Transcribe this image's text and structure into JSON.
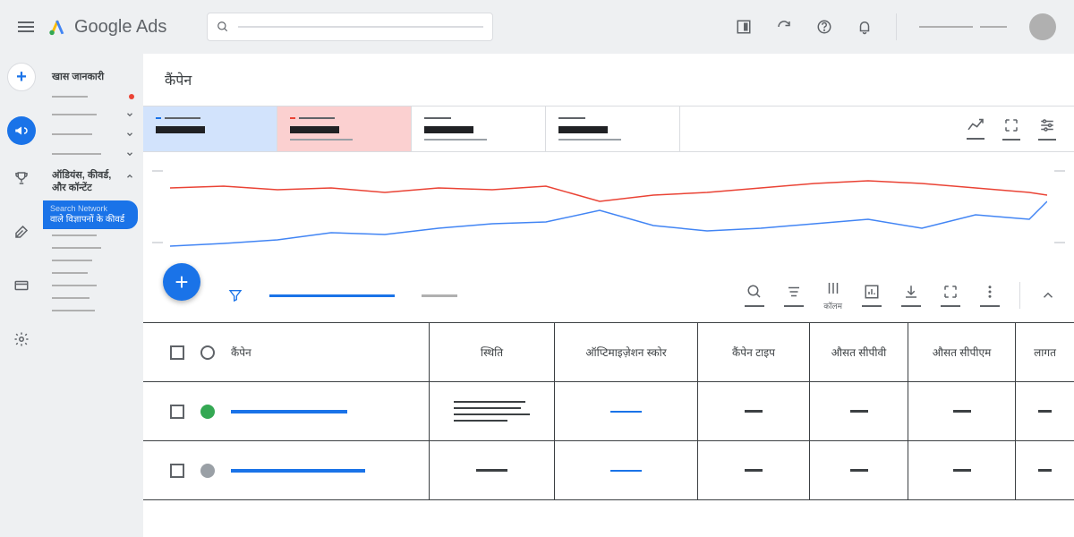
{
  "header": {
    "logo_text": "Google Ads"
  },
  "rail": {
    "campaign_label": "कैंपेन"
  },
  "sidebar": {
    "overview": "खास जानकारी",
    "audiences": "ऑडियंस, कीवर्ड, और कॉन्टेंट",
    "pill_top": "Search Network",
    "pill_bottom": "वाले विज्ञापनों के कीवर्ड"
  },
  "page": {
    "title": "कैंपेन"
  },
  "toolbar": {
    "columns_label": "कॉलम"
  },
  "table": {
    "headers": {
      "campaign": "कैंपेन",
      "status": "स्थिति",
      "opt_score": "ऑप्टिमाइज़ेशन स्कोर",
      "type": "कैंपेन टाइप",
      "cpv": "औसत सीपीवी",
      "cpm": "औसत सीपीएम",
      "cost": "लागत"
    }
  }
}
